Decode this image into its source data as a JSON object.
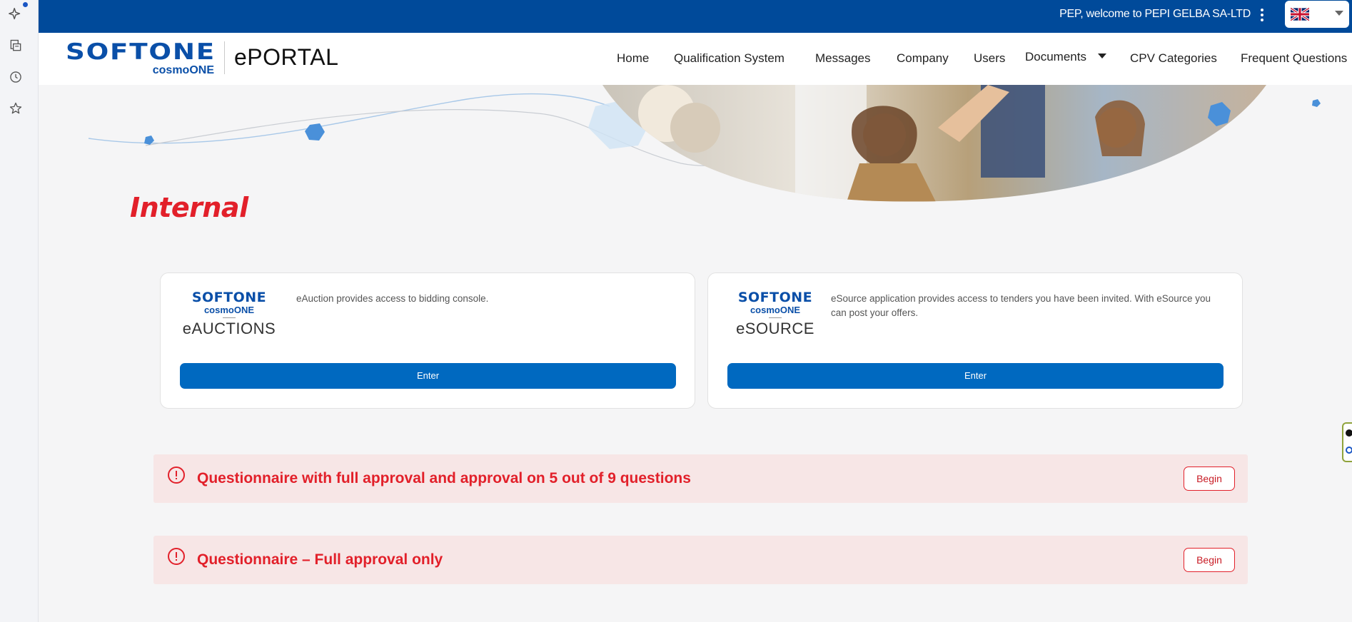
{
  "topbar": {
    "welcome": "PEP, welcome to PEPI GELBA SA-LTD",
    "language_flag": "uk-flag-icon"
  },
  "header": {
    "logo_brand": "SOFTONE",
    "logo_sub": "cosmoONE",
    "portal_name": "ePORTAL",
    "nav": [
      "Home",
      "Qualification System",
      "Messages",
      "Company",
      "Users",
      "Documents",
      "CPV Categories",
      "Frequent Questions"
    ]
  },
  "main": {
    "title": "Internal",
    "cards": [
      {
        "brand": "SOFTONE",
        "sub": "cosmoONE",
        "app": "eAUCTIONS",
        "description": "eAuction provides access to bidding console.",
        "button": "Enter"
      },
      {
        "brand": "SOFTONE",
        "sub": "cosmoONE",
        "app": "eSOURCE",
        "description": "eSource application provides access to tenders you have been invited. With eSource you can post your offers.",
        "button": "Enter"
      }
    ],
    "questionnaires": [
      {
        "text": "Questionnaire with full approval and approval on 5 out of 9 questions",
        "button": "Begin"
      },
      {
        "text": "Questionnaire – Full approval only",
        "button": "Begin"
      }
    ]
  },
  "colors": {
    "topbar": "#004a9a",
    "brand_blue": "#0a4fa8",
    "button_blue": "#0069c0",
    "accent_red": "#e2202a",
    "alert_bg": "#f7e6e6"
  }
}
